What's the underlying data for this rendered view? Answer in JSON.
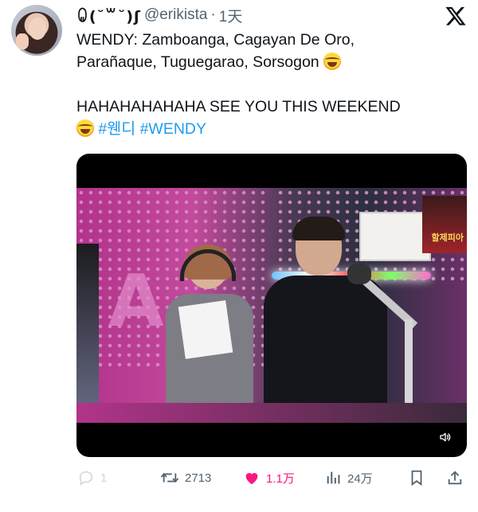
{
  "tweet": {
    "display_name": "ꐑ(˘꒳˘)ʃ",
    "handle": "@erikista",
    "separator": "·",
    "time": "1天",
    "text": {
      "line1": "WENDY: Zamboanga, Cagayan De Oro,",
      "line2": "Parañaque, Tuguegarao, Sorsogon",
      "line3": "HAHAHAHAHAHA SEE YOU THIS WEEKEND",
      "hashtag1": "#웬디",
      "hashtag2": "#WENDY"
    },
    "emoji": "laughing-tears",
    "media": {
      "type": "video",
      "overlay_text": "할제피아",
      "volume_icon": "speaker-icon"
    },
    "actions": {
      "reply_count": "1",
      "retweet_count": "2713",
      "like_count": "1.1万",
      "views_count": "24万"
    }
  },
  "colors": {
    "link": "#1d9bf0",
    "like": "#f91880",
    "muted": "#536471",
    "text": "#0f1419"
  }
}
